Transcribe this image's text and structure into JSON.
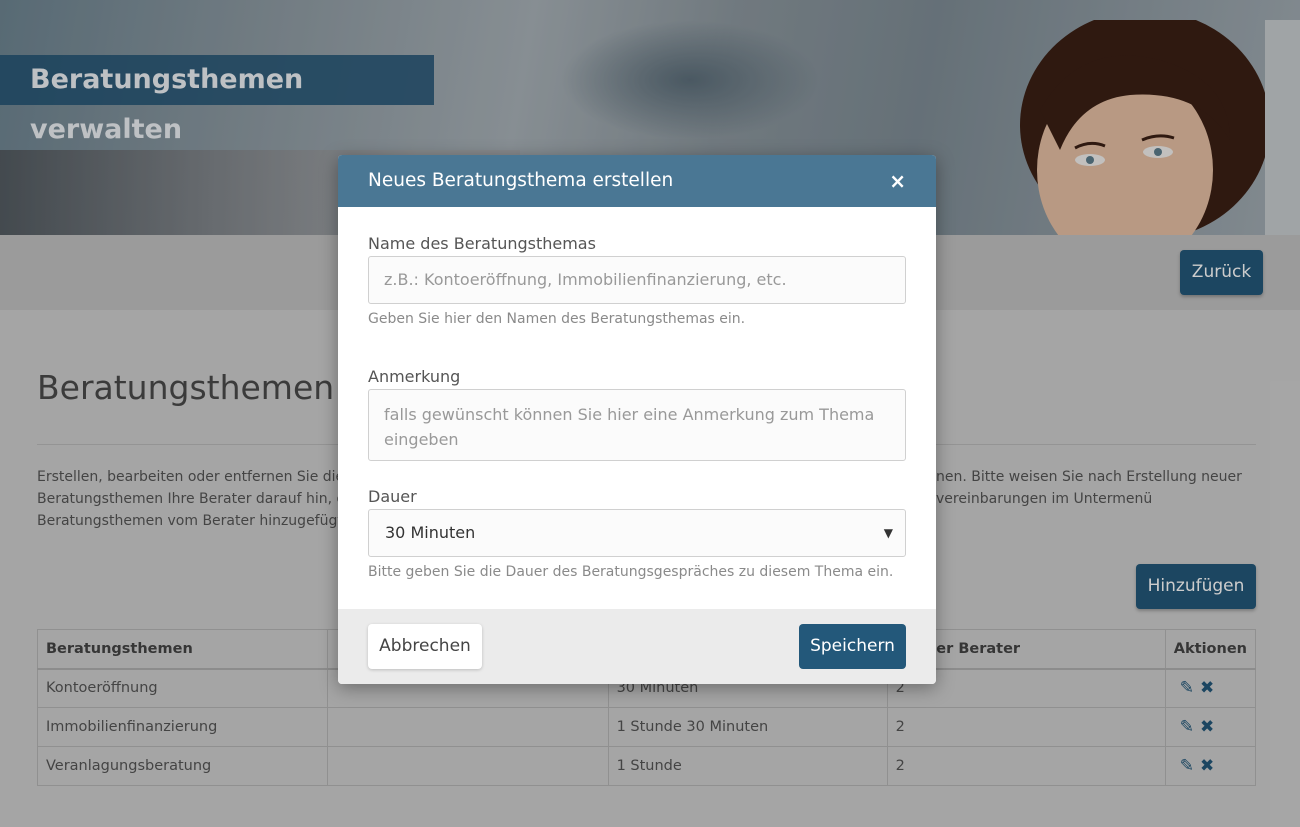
{
  "hero": {
    "title": "Beratungsthemen verwalten"
  },
  "toolbar": {
    "back_label": "Zurück"
  },
  "main": {
    "heading": "Beratungsthemen verwalten",
    "description_lines": [
      "Erstellen, bearbeiten oder entfernen Sie die",
      "Beratungsthemen Ihre Berater darauf hin, di",
      "Beratungsthemen vom Berater hinzugefügt"
    ],
    "description_right_lines": [
      "nen. Bitte weisen Sie nach Erstellung neuer",
      "vereinbarungen im Untermenü"
    ],
    "add_label": "Hinzufügen"
  },
  "table": {
    "headers": [
      "Beratungsthemen",
      "",
      "",
      "hl der Berater",
      "Aktionen"
    ],
    "rows": [
      {
        "name": "Kontoeröffnung",
        "note": "",
        "duration": "30 Minuten",
        "advisors": "2"
      },
      {
        "name": "Immobilienfinanzierung",
        "note": "",
        "duration": "1 Stunde 30 Minuten",
        "advisors": "2"
      },
      {
        "name": "Veranlagungsberatung",
        "note": "",
        "duration": "1 Stunde",
        "advisors": "2"
      }
    ]
  },
  "modal": {
    "title": "Neues Beratungsthema erstellen",
    "close_symbol": "×",
    "name_label": "Name des Beratungsthemas",
    "name_placeholder": "z.B.: Kontoeröffnung, Immobilienfinanzierung, etc.",
    "name_hint": "Geben Sie hier den Namen des Beratungsthemas ein.",
    "note_label": "Anmerkung",
    "note_placeholder": "falls gewünscht können Sie hier eine Anmerkung zum Thema eingeben",
    "duration_label": "Dauer",
    "duration_value": "30 Minuten",
    "duration_hint": "Bitte geben Sie die Dauer des Beratungsgespräches zu diesem Thema ein.",
    "cancel_label": "Abbrechen",
    "save_label": "Speichern"
  },
  "icons": {
    "edit": "pencil-icon",
    "delete": "x-icon"
  },
  "colors": {
    "primary": "#23587a",
    "modal_header": "#4a7794"
  }
}
